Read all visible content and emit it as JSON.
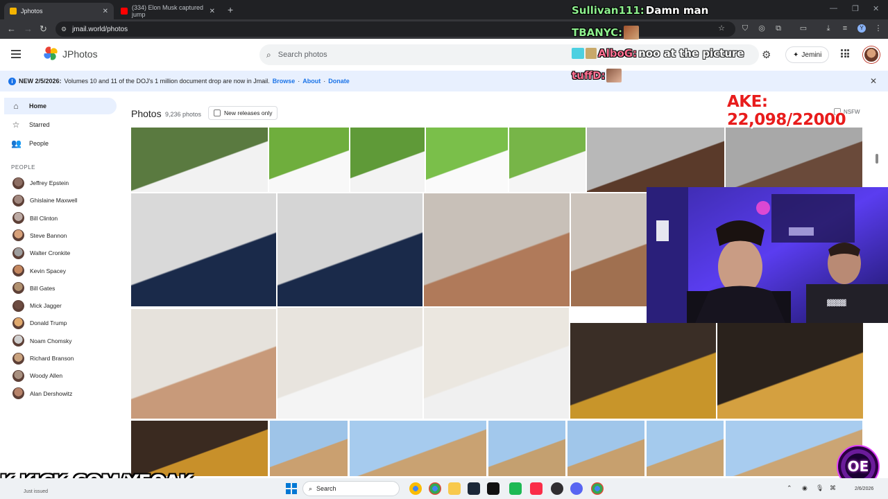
{
  "browser": {
    "tabs": [
      {
        "label": "Jphotos",
        "active": true,
        "favicon_color": "#f4b400"
      },
      {
        "label": "(334) Elon Musk captured jump",
        "active": false,
        "favicon_color": "#ff0000"
      }
    ],
    "new_tab_symbol": "+",
    "url": "jmail.world/photos"
  },
  "app": {
    "title": "JPhotos",
    "search_placeholder": "Search photos",
    "gemini_label": "Jemini"
  },
  "banner": {
    "prefix": "NEW 2/5/2026:",
    "text": "Volumes 10 and 11 of the DOJ's 1 million document drop are now in Jmail.",
    "browse": "Browse",
    "about": "About",
    "donate": "Donate",
    "sep": "·"
  },
  "sidebar": {
    "nav": [
      {
        "label": "Home",
        "icon": "home-icon",
        "active": true
      },
      {
        "label": "Starred",
        "icon": "star-icon",
        "active": false
      },
      {
        "label": "People",
        "icon": "people-icon",
        "active": false
      }
    ],
    "people_heading": "PEOPLE",
    "people": [
      {
        "name": "Jeffrey Epstein",
        "color": "#8d6e63"
      },
      {
        "name": "Ghislaine Maxwell",
        "color": "#a1887f"
      },
      {
        "name": "Bill Clinton",
        "color": "#bcaaa4"
      },
      {
        "name": "Steve Bannon",
        "color": "#d7a17a"
      },
      {
        "name": "Walter Cronkite",
        "color": "#9e9e9e"
      },
      {
        "name": "Kevin Spacey",
        "color": "#c4875f"
      },
      {
        "name": "Bill Gates",
        "color": "#b0906f"
      },
      {
        "name": "Mick Jagger",
        "color": "#6d4c41"
      },
      {
        "name": "Donald Trump",
        "color": "#e0a96d"
      },
      {
        "name": "Noam Chomsky",
        "color": "#cfcfcf"
      },
      {
        "name": "Richard Branson",
        "color": "#c9a27e"
      },
      {
        "name": "Woody Allen",
        "color": "#a89080"
      },
      {
        "name": "Alan Dershowitz",
        "color": "#b7836a"
      }
    ]
  },
  "main": {
    "title": "Photos",
    "count": "9,236 photos",
    "new_releases_label": "New releases only",
    "nsfw_label": "NSFW"
  },
  "overlay": {
    "chat": [
      {
        "user": "Sullivan111:",
        "message": "Damn man"
      },
      {
        "user": "TBANYC:",
        "message": ""
      },
      {
        "user": "AlboG:",
        "message": "noo at the picture"
      },
      {
        "user": "tuffD:",
        "message": ""
      }
    ],
    "goal": "AKE: 22,098/22000",
    "kick_url": "K KICK.COM/YEOAK",
    "badge_text": "OE",
    "brand_color": "#53fc18",
    "accent_red": "#e81c1c"
  },
  "taskbar": {
    "search_label": "Search",
    "notification": "Just issued",
    "date": "2/6/2026"
  }
}
